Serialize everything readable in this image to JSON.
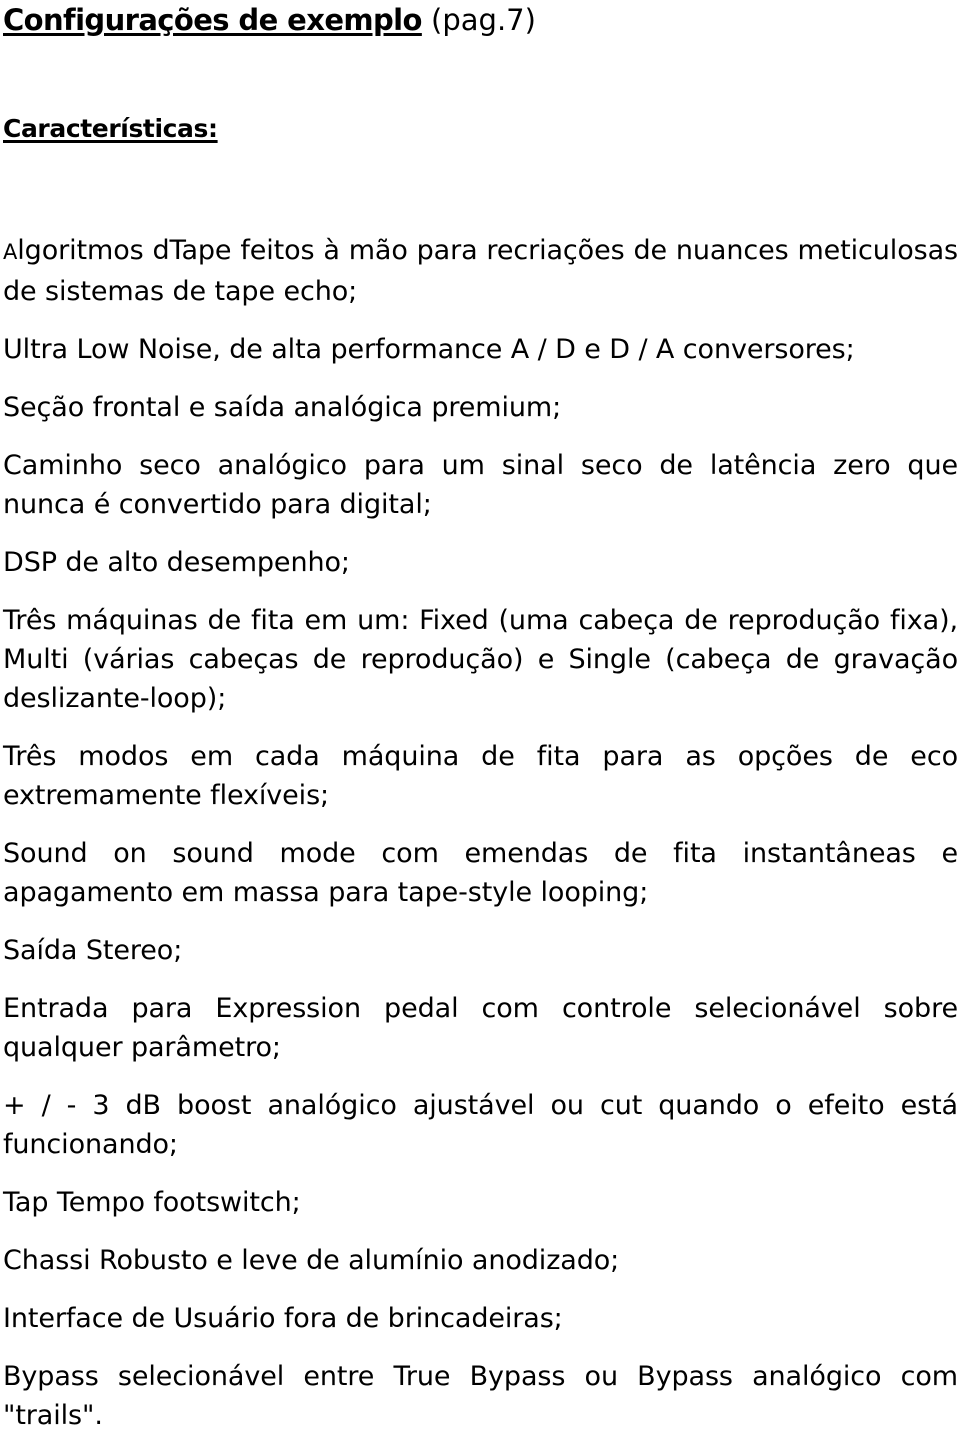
{
  "heading": {
    "title_main": "Configurações de exemplo",
    "title_page_ref": " (pag.7)"
  },
  "section": {
    "title": "Características:"
  },
  "features": [
    {
      "lead_char": "A",
      "text": "lgoritmos dTape feitos à mão para recriações de nuances meticulosas de sistemas de tape echo;",
      "multiline": true
    },
    {
      "lead_char": "",
      "text": "Ultra Low Noise, de alta performance A / D e D / A conversores;",
      "multiline": false
    },
    {
      "lead_char": "",
      "text": "Seção frontal e saída analógica premium;",
      "multiline": false
    },
    {
      "lead_char": "",
      "text": "Caminho seco analógico para um sinal seco de latência zero que nunca é convertido para digital;",
      "multiline": true
    },
    {
      "lead_char": "",
      "text": "DSP de alto desempenho;",
      "multiline": false
    },
    {
      "lead_char": "",
      "text": "Três máquinas de fita em um: Fixed (uma cabeça de reprodução fixa), Multi (várias cabeças de reprodução) e Single (cabeça de gravação deslizante-loop);",
      "multiline": true
    },
    {
      "lead_char": "",
      "text": "Três modos em cada máquina de fita para as opções de eco extremamente flexíveis;",
      "multiline": true
    },
    {
      "lead_char": "",
      "text": "Sound on sound mode com emendas de fita instantâneas e apagamento em massa para  tape-style looping;",
      "multiline": true
    },
    {
      "lead_char": "",
      "text": "Saída Stereo;",
      "multiline": false
    },
    {
      "lead_char": "",
      "text": "Entrada para Expression pedal com controle selecionável sobre qualquer parâmetro;",
      "multiline": true
    },
    {
      "lead_char": "",
      "text": "+ / - 3 dB boost analógico ajustável ou cut quando o efeito está funcionando;",
      "multiline": true
    },
    {
      "lead_char": "",
      "text": "Tap Tempo footswitch;",
      "multiline": false
    },
    {
      "lead_char": "",
      "text": "Chassi Robusto e leve de alumínio anodizado;",
      "multiline": false
    },
    {
      "lead_char": "",
      "text": "Interface de Usuário fora de brincadeiras;",
      "multiline": false
    },
    {
      "lead_char": "",
      "text": "Bypass selecionável entre True Bypass ou Bypass analógico com \"trails\".",
      "multiline": true
    }
  ],
  "colors": {
    "text": "#000000",
    "background": "#ffffff"
  }
}
